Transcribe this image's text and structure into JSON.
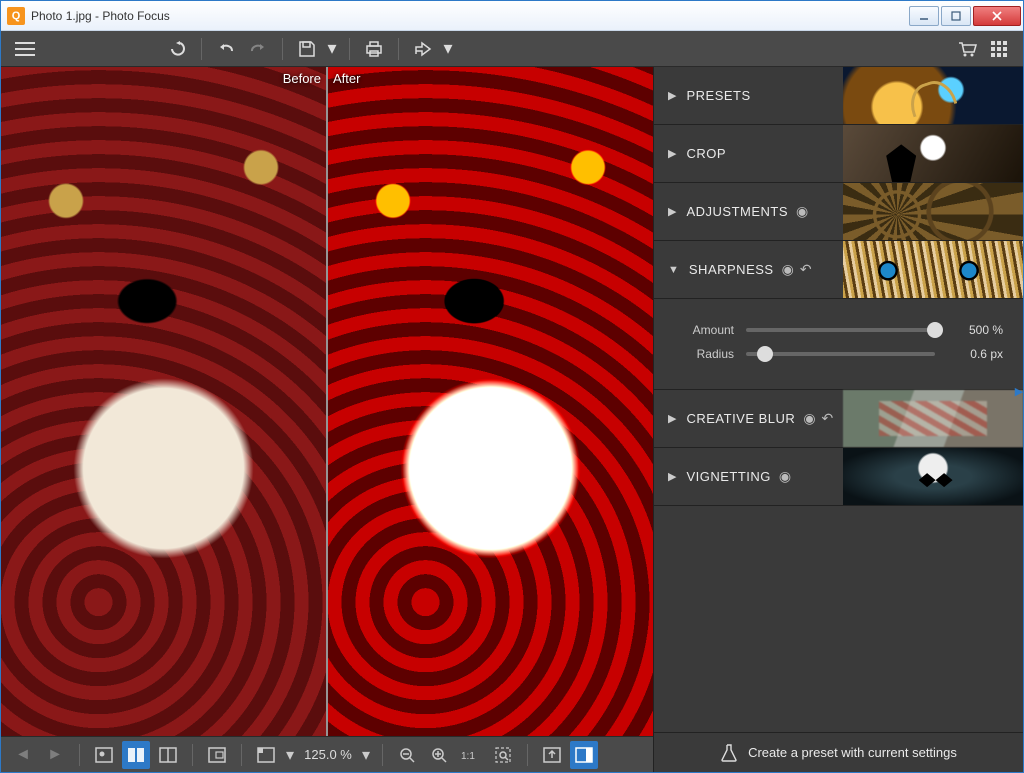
{
  "window": {
    "title": "Photo 1.jpg - Photo Focus",
    "app_icon_letter": "Q"
  },
  "toolbar": {
    "menu": "menu",
    "undo_all": "undo-all",
    "undo": "undo",
    "redo": "redo",
    "save": "save",
    "print": "print",
    "share": "share",
    "cart": "cart",
    "grid": "grid"
  },
  "canvas": {
    "before_label": "Before",
    "after_label": "After"
  },
  "bottombar": {
    "zoom_value": "125.0 %"
  },
  "panel": {
    "sections": {
      "presets": {
        "label": "PRESETS",
        "expanded": false,
        "has_eye": false,
        "has_reset": false
      },
      "crop": {
        "label": "CROP",
        "expanded": false,
        "has_eye": false,
        "has_reset": false
      },
      "adjustments": {
        "label": "ADJUSTMENTS",
        "expanded": false,
        "has_eye": true,
        "has_reset": false
      },
      "sharpness": {
        "label": "SHARPNESS",
        "expanded": true,
        "has_eye": true,
        "has_reset": true
      },
      "creative_blur": {
        "label": "CREATIVE BLUR",
        "expanded": false,
        "has_eye": true,
        "has_reset": true
      },
      "vignetting": {
        "label": "VIGNETTING",
        "expanded": false,
        "has_eye": true,
        "has_reset": false
      }
    },
    "sharpness": {
      "amount": {
        "label": "Amount",
        "value": "500 %",
        "pos_pct": 100
      },
      "radius": {
        "label": "Radius",
        "value": "0.6 px",
        "pos_pct": 10
      }
    },
    "footer": "Create a preset with current settings"
  }
}
